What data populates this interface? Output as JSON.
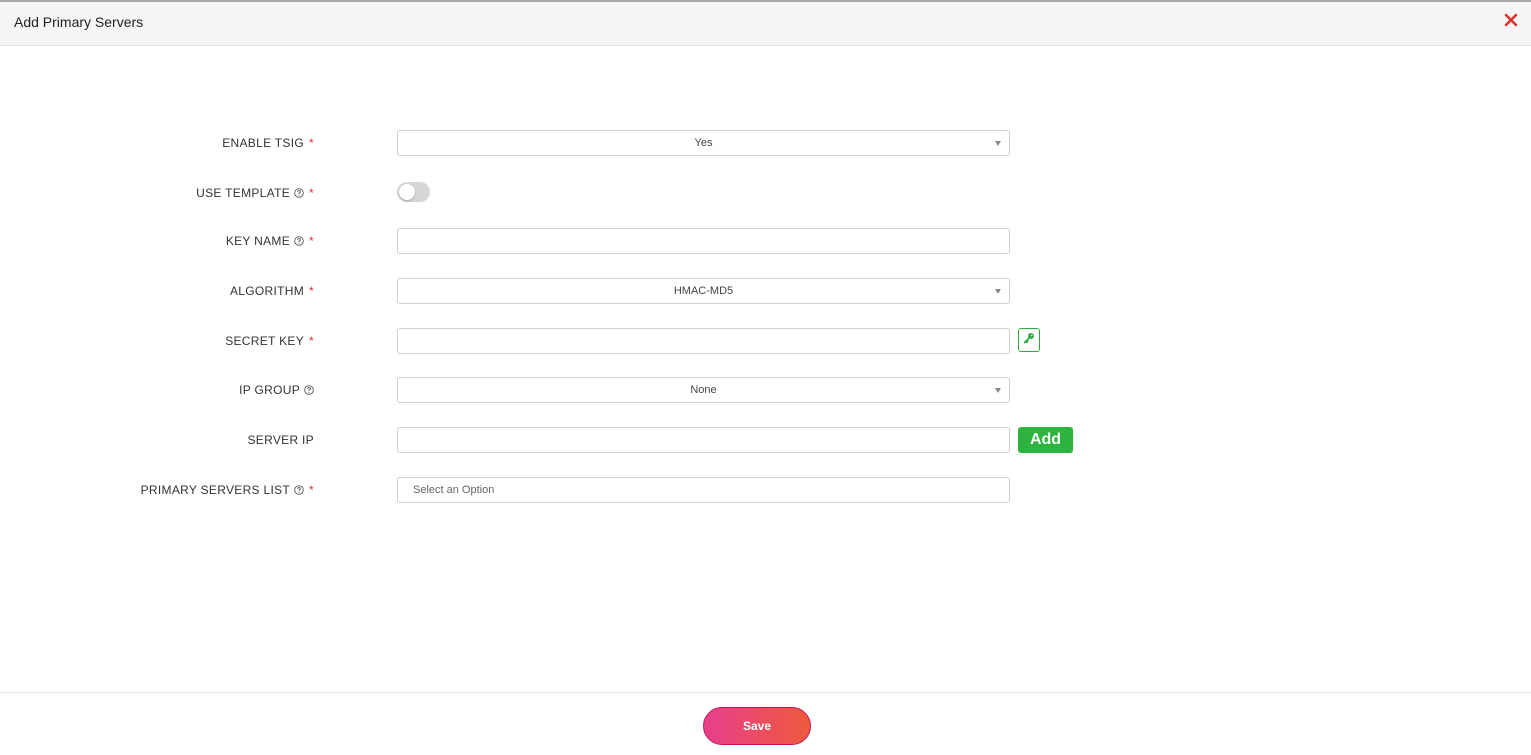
{
  "dialog": {
    "title": "Add Primary Servers",
    "close_icon": "close-icon",
    "accent_close_color": "#e0312b"
  },
  "form": {
    "enable_tsig": {
      "label": "ENABLE TSIG",
      "required": "*",
      "value": "Yes"
    },
    "use_template": {
      "label": "USE TEMPLATE",
      "required": "*",
      "help_icon": "help-circle-icon",
      "toggle_state": "off"
    },
    "key_name": {
      "label": "KEY NAME",
      "required": "*",
      "help_icon": "help-circle-icon",
      "value": ""
    },
    "algorithm": {
      "label": "ALGORITHM",
      "required": "*",
      "value": "HMAC-MD5"
    },
    "secret_key": {
      "label": "SECRET KEY",
      "required": "*",
      "value": "",
      "generate_icon": "key-icon"
    },
    "ip_group": {
      "label": "IP GROUP",
      "help_icon": "help-circle-icon",
      "value": "None"
    },
    "server_ip": {
      "label": "SERVER IP",
      "value": "",
      "add_label": "Add"
    },
    "primary_servers_list": {
      "label": "PRIMARY SERVERS LIST",
      "required": "*",
      "help_icon": "help-circle-icon",
      "placeholder": "Select an Option"
    }
  },
  "footer": {
    "save_label": "Save"
  },
  "colors": {
    "required": "#e0312b",
    "add_button": "#2eb33f",
    "save_gradient_start": "#e83e8c",
    "save_gradient_end": "#ef5a3c"
  }
}
